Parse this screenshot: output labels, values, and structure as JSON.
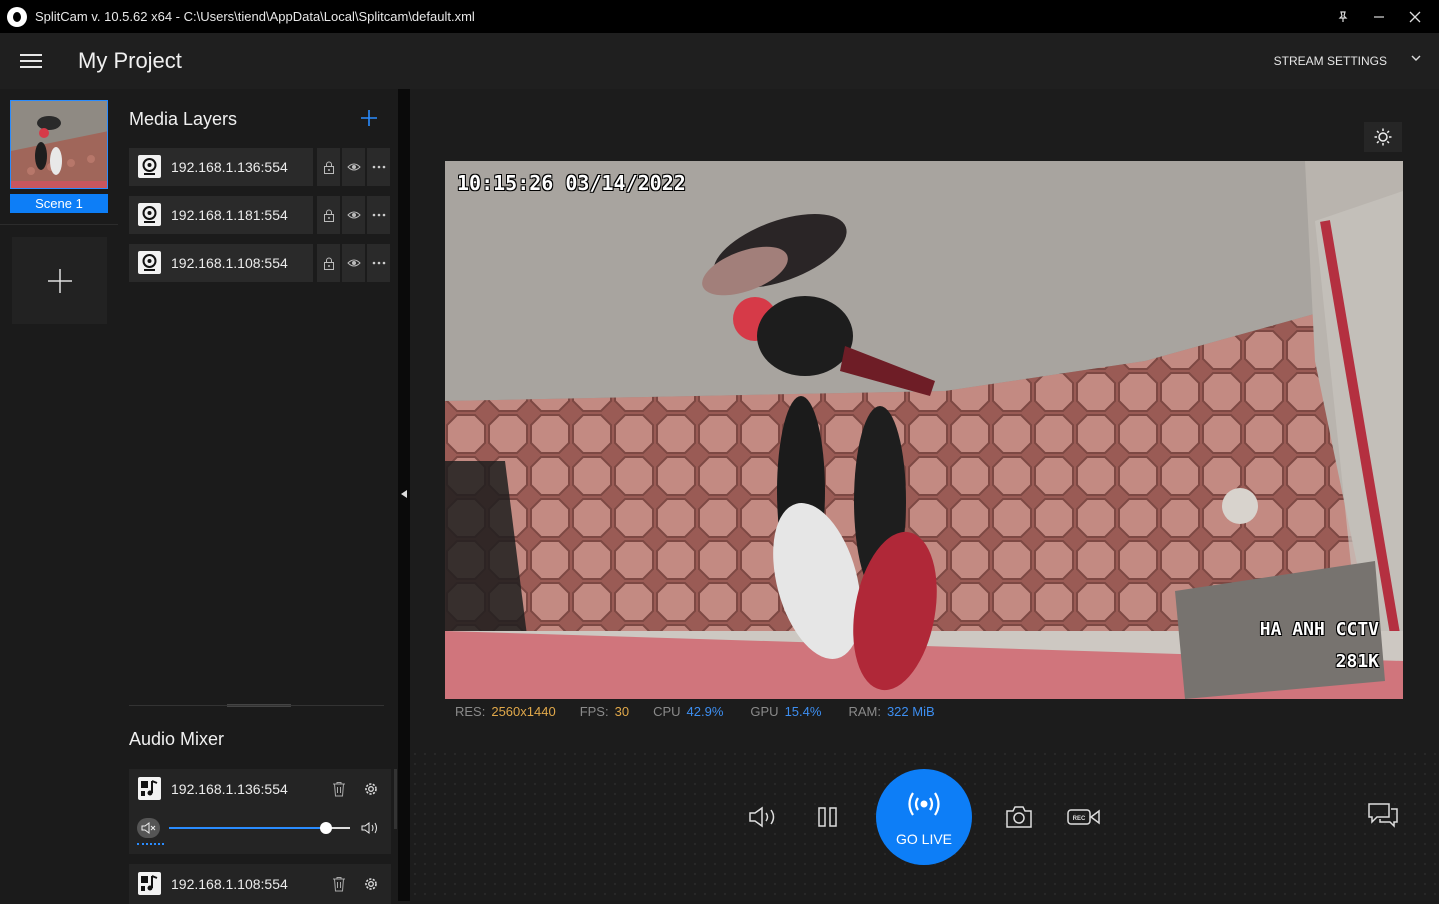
{
  "window": {
    "title": "SplitCam v. 10.5.62 x64 - C:\\Users\\tiend\\AppData\\Local\\Splitcam\\default.xml"
  },
  "header": {
    "project_title": "My Project",
    "stream_settings_label": "STREAM SETTINGS"
  },
  "scenes": {
    "items": [
      {
        "label": "Scene 1",
        "selected": true
      }
    ]
  },
  "media_layers": {
    "title": "Media Layers",
    "items": [
      {
        "label": "192.168.1.136:554"
      },
      {
        "label": "192.168.1.181:554"
      },
      {
        "label": "192.168.1.108:554"
      }
    ]
  },
  "audio_mixer": {
    "title": "Audio Mixer",
    "items": [
      {
        "label": "192.168.1.136:554",
        "volume": 0.87,
        "muted": true
      },
      {
        "label": "192.168.1.108:554"
      }
    ]
  },
  "preview": {
    "timestamp": "10:15:26 03/14/2022",
    "watermark_line1": "HA ANH CCTV",
    "watermark_line2": "281K"
  },
  "stats": {
    "res_label": "RES:",
    "res_value": "2560x1440",
    "fps_label": "FPS:",
    "fps_value": "30",
    "cpu_label": "CPU",
    "cpu_value": "42.9%",
    "gpu_label": "GPU",
    "gpu_value": "15.4%",
    "ram_label": "RAM:",
    "ram_value": "322 MiB"
  },
  "controls": {
    "go_live_label": "GO LIVE",
    "rec_label": "REC"
  },
  "colors": {
    "accent": "#0d7ef7",
    "res_value": "#e0a84a",
    "fps_value": "#e0a84a",
    "cpu_value": "#3d8ef0",
    "gpu_value": "#3d8ef0",
    "ram_value": "#3d8ef0"
  }
}
